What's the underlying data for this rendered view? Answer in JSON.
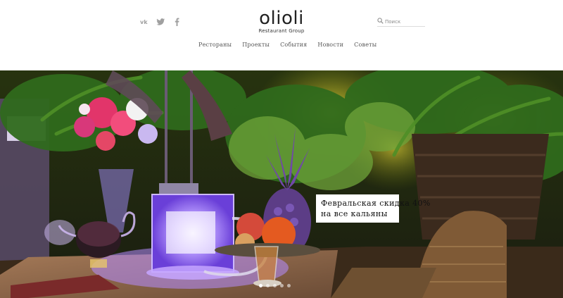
{
  "header": {
    "social": [
      {
        "icon": "vk-icon"
      },
      {
        "icon": "twitter-icon"
      },
      {
        "icon": "facebook-icon"
      }
    ],
    "logo": {
      "title": "olioli",
      "subtitle": "Restaurant Group"
    },
    "search": {
      "placeholder": "Поиск",
      "value": ""
    },
    "nav": [
      "Рестораны",
      "Проекты",
      "События",
      "Новости",
      "Советы"
    ]
  },
  "hero": {
    "promo_line1": "Февральская скидка 40%",
    "promo_line2": "на все кальяны",
    "slides": 5,
    "active_slide": 1
  },
  "colors": {
    "header_bg": "#ffffff",
    "icon_gray": "#a0a0a0",
    "nav_text": "#555555",
    "hookah_glow": "#9a6bff"
  }
}
